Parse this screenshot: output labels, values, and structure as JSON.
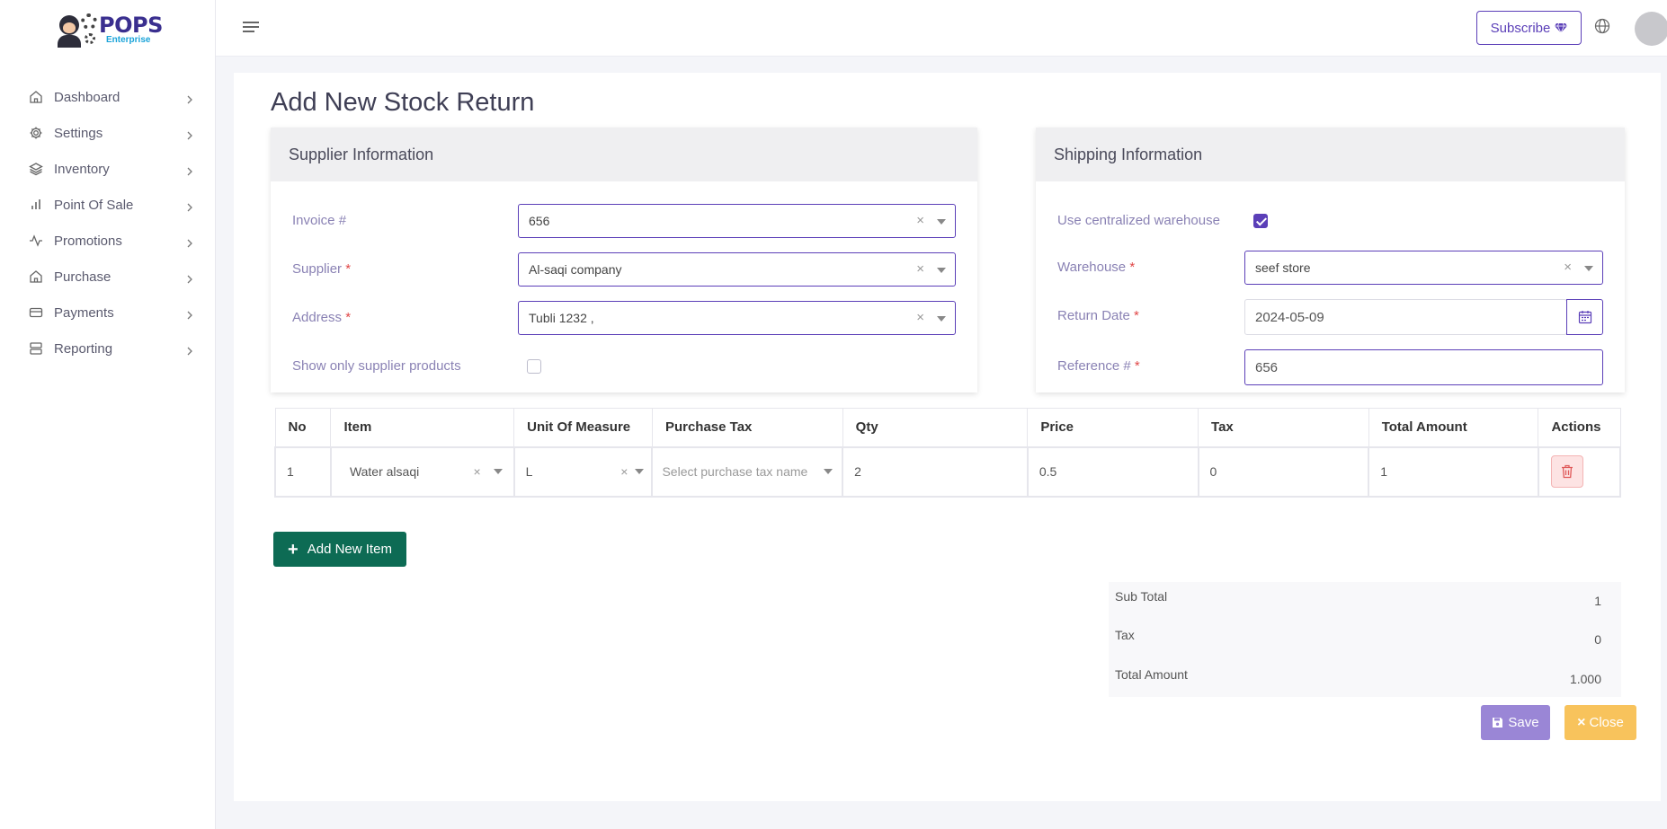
{
  "app": {
    "logo_text": "POPS",
    "logo_sub": "Enterprise"
  },
  "sidebar": {
    "items": [
      {
        "label": "Dashboard",
        "icon": "home-icon"
      },
      {
        "label": "Settings",
        "icon": "gear-icon"
      },
      {
        "label": "Inventory",
        "icon": "layers-icon"
      },
      {
        "label": "Point Of Sale",
        "icon": "bar-chart-icon"
      },
      {
        "label": "Promotions",
        "icon": "activity-icon"
      },
      {
        "label": "Purchase",
        "icon": "home-icon"
      },
      {
        "label": "Payments",
        "icon": "credit-card-icon"
      },
      {
        "label": "Reporting",
        "icon": "server-icon"
      }
    ]
  },
  "topbar": {
    "subscribe_label": "Subscribe"
  },
  "page": {
    "title": "Add New Stock Return"
  },
  "supplier": {
    "heading": "Supplier Information",
    "invoice_label": "Invoice #",
    "invoice_value": "656",
    "supplier_label": "Supplier",
    "supplier_value": "Al-saqi company",
    "address_label": "Address",
    "address_value": "Tubli 1232 ,",
    "show_only_label": "Show only supplier products",
    "show_only_checked": false
  },
  "shipping": {
    "heading": "Shipping Information",
    "centralized_label": "Use centralized warehouse",
    "centralized_checked": true,
    "warehouse_label": "Warehouse",
    "warehouse_value": "seef store",
    "return_date_label": "Return Date",
    "return_date_value": "2024-05-09",
    "reference_label": "Reference #",
    "reference_value": "656"
  },
  "table": {
    "headers": [
      "No",
      "Item",
      "Unit Of Measure",
      "Purchase Tax",
      "Qty",
      "Price",
      "Tax",
      "Total Amount",
      "Actions"
    ],
    "rows": [
      {
        "no": "1",
        "item": "Water alsaqi",
        "uom": "L",
        "tax_placeholder": "Select purchase tax name",
        "qty": "2",
        "price": "0.5",
        "tax": "0",
        "total": "1"
      }
    ]
  },
  "add_item_label": "Add New Item",
  "totals": {
    "sub_total_label": "Sub Total",
    "sub_total_value": "1",
    "tax_label": "Tax",
    "tax_value": "0",
    "total_label": "Total Amount",
    "total_value": "1.000"
  },
  "actions": {
    "save_label": "Save",
    "close_label": "Close"
  },
  "colors": {
    "accent": "#5b3fb8",
    "add_button": "#0d6b54",
    "save_button": "#9a86d6",
    "close_button": "#f8c35c",
    "required": "#e04848"
  }
}
